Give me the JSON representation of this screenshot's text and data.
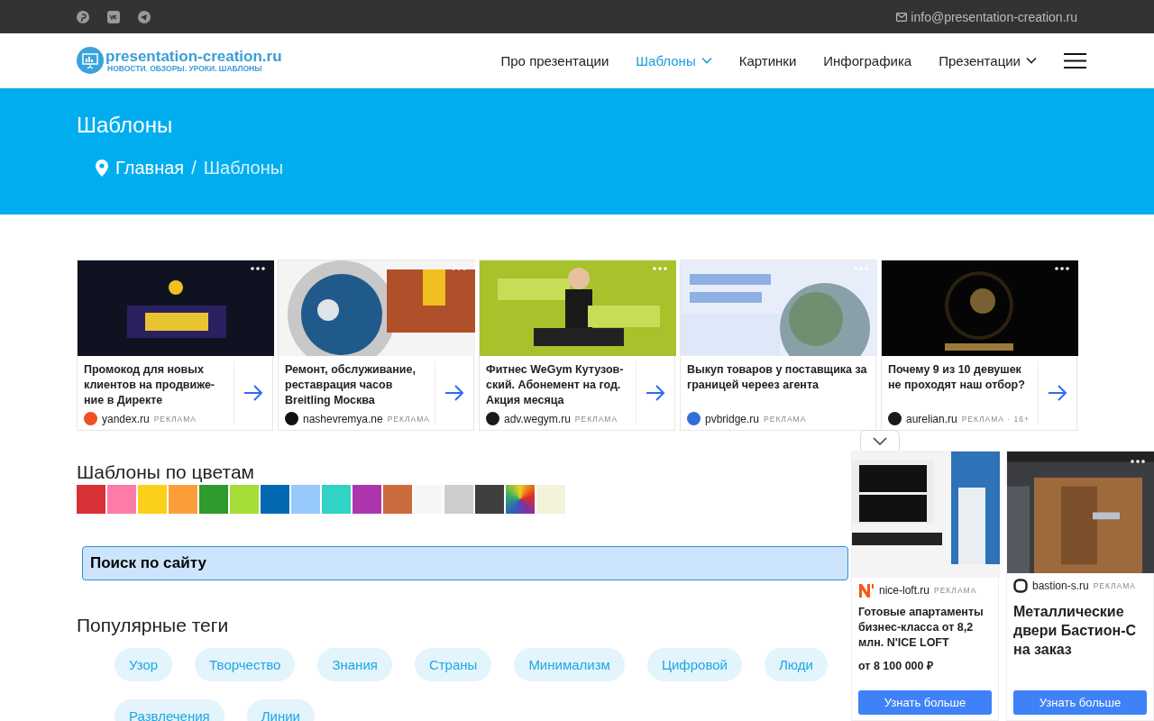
{
  "top_bar": {
    "email": "info@presentation-creation.ru"
  },
  "header": {
    "logo_title": "presentation-creation.ru",
    "logo_subtitle": "НОВОСТИ. ОБЗОРЫ. УРОКИ. ШАБЛОНЫ",
    "nav": [
      {
        "label": "Про презентации",
        "selected": false,
        "dropdown": false
      },
      {
        "label": "Шаблоны",
        "selected": true,
        "dropdown": true
      },
      {
        "label": "Картинки",
        "selected": false,
        "dropdown": false
      },
      {
        "label": "Инфографика",
        "selected": false,
        "dropdown": false
      },
      {
        "label": "Презентации",
        "selected": false,
        "dropdown": true
      }
    ]
  },
  "hero": {
    "title": "Шаблоны",
    "breadcrumbs": [
      {
        "label": "Главная"
      },
      {
        "label": "Шаблоны"
      }
    ],
    "separator": "/"
  },
  "ads": [
    {
      "title": "Промокод для новых клиентов на продвиже-ние в Директе",
      "domain": "yandex.ru",
      "label": "РЕКЛАМА",
      "arrow": true,
      "color": "#f04e23"
    },
    {
      "title": "Ремонт, обслуживание, реставрация часов Breitling Москва",
      "domain": "nashevremya.ne",
      "label": "РЕКЛАМА",
      "arrow": true,
      "color": "#111111"
    },
    {
      "title": "Фитнес WeGym Кутузов-ский. Абонемент на год. Акция месяца",
      "domain": "adv.wegym.ru",
      "label": "РЕКЛАМА",
      "arrow": true,
      "color": "#1a1a1a"
    },
    {
      "title": "Выкуп товаров у поставщика за границей череез агента",
      "domain": "pvbridge.ru",
      "label": "РЕКЛАМА",
      "arrow": false,
      "color": "#2f6fd6"
    },
    {
      "title": "Почему 9 из 10 девушек не проходят наш отбор?",
      "domain": "aurelian.ru",
      "label": "РЕКЛАМА · 16+",
      "arrow": true,
      "color": "#1a1a1a"
    }
  ],
  "colors": {
    "title": "Шаблоны по цветам",
    "swatches": [
      {
        "kind": "solid",
        "color": "#d83236"
      },
      {
        "kind": "solid",
        "color": "#fc7ba9"
      },
      {
        "kind": "solid",
        "color": "#fcd01a"
      },
      {
        "kind": "solid",
        "color": "#fb9e3a"
      },
      {
        "kind": "solid",
        "color": "#2f9a2d"
      },
      {
        "kind": "solid",
        "color": "#a6de38"
      },
      {
        "kind": "solid",
        "color": "#0469b3"
      },
      {
        "kind": "solid",
        "color": "#98c9fd"
      },
      {
        "kind": "solid",
        "color": "#31d3c6"
      },
      {
        "kind": "solid",
        "color": "#ae35ae"
      },
      {
        "kind": "solid",
        "color": "#cb6a3d"
      },
      {
        "kind": "solid",
        "color": "#f6f6f6"
      },
      {
        "kind": "solid",
        "color": "#cdcdcd"
      },
      {
        "kind": "solid",
        "color": "#3f3f3f"
      },
      {
        "kind": "multicolor"
      },
      {
        "kind": "solid",
        "color": "#f3f3dc"
      }
    ]
  },
  "search": {
    "placeholder": "Поиск по сайту"
  },
  "tags": {
    "title": "Популярные теги",
    "items": [
      "Узор",
      "Творчество",
      "Знания",
      "Страны",
      "Минимализм",
      "Цифровой",
      "Люди",
      "Развлечения",
      "Линии"
    ]
  },
  "side_ads": [
    {
      "domain": "nice-loft.ru",
      "label": "РЕКЛАМА",
      "title": "Готовые апартаменты бизнес-класса от 8,2 млн. N'ICE LOFT",
      "price": "от 8 100 000 ₽",
      "button": "Узнать больше",
      "kind": "small"
    },
    {
      "domain": "bastion-s.ru",
      "label": "РЕКЛАМА",
      "title": "Металлические двери Бастион-С на заказ",
      "button": "Узнать больше",
      "kind": "large"
    }
  ]
}
